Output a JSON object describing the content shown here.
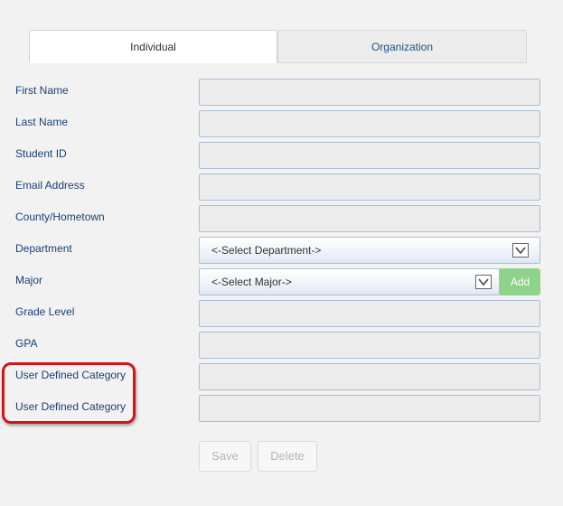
{
  "tabs": {
    "individual": "Individual",
    "organization": "Organization"
  },
  "form": {
    "first_name": "First Name",
    "last_name": "Last Name",
    "student_id": "Student ID",
    "email": "Email Address",
    "county": "County/Hometown",
    "department": "Department",
    "department_select": "<-Select Department->",
    "major": "Major",
    "major_select": "<-Select Major->",
    "add": "Add",
    "grade_level": "Grade Level",
    "gpa": "GPA",
    "user_defined_1": "User Defined Category",
    "user_defined_2": "User Defined Category"
  },
  "actions": {
    "save": "Save",
    "delete": "Delete"
  },
  "colors": {
    "label": "#1b3f77",
    "add_button": "#8fd38a",
    "highlight": "#d4141c"
  }
}
